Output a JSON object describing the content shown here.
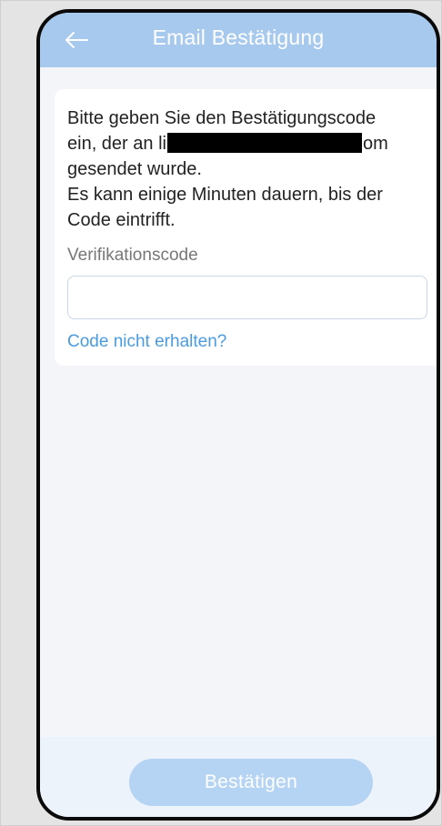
{
  "header": {
    "title": "Email Bestätigung",
    "back_icon": "arrow-left-icon"
  },
  "instructions": {
    "line1": "Bitte geben Sie den Bestätigungscode",
    "line2_prefix": "ein, der an li",
    "line2_suffix": "om",
    "line3": "gesendet wurde.",
    "line4": "Es kann einige Minuten dauern, bis der",
    "line5": "Code eintrifft."
  },
  "form": {
    "code_label": "Verifikationscode",
    "code_value": "",
    "code_placeholder": ""
  },
  "resend_link": "Code nicht erhalten?",
  "footer": {
    "confirm_label": "Bestätigen"
  },
  "colors": {
    "header_bg": "#a8c9ee",
    "link": "#4a9be0",
    "button_disabled": "#b5d3f2"
  }
}
